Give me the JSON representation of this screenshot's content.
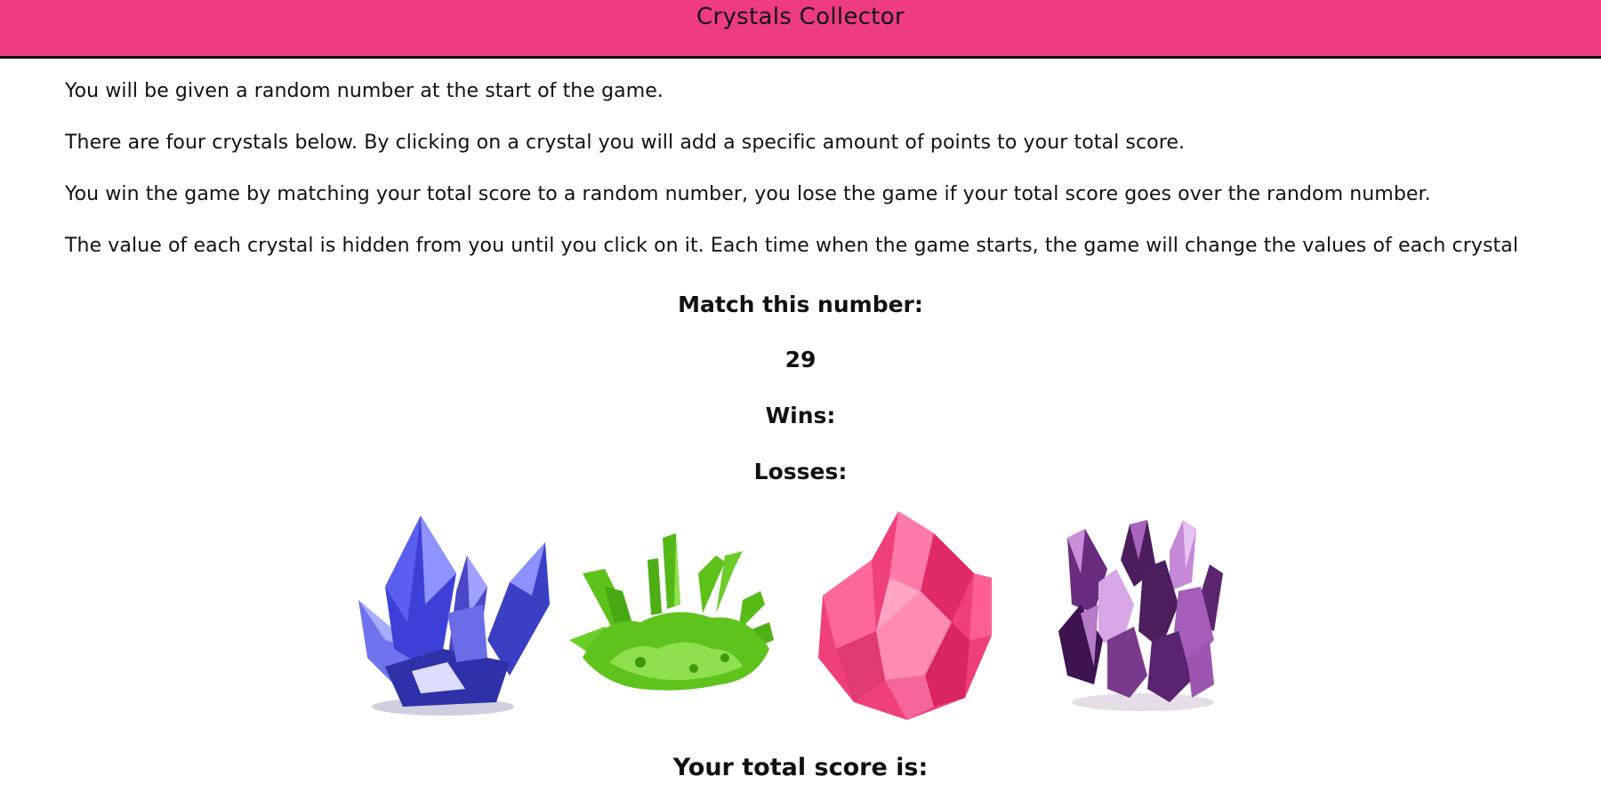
{
  "header": {
    "title": "Crystals Collector",
    "color": "#ee3b82"
  },
  "instructions": [
    "You will be given a random number at the start of the game.",
    "There are four crystals below. By clicking on a crystal you will add a specific amount of points to your total score.",
    "You win the game by matching your total score to a random number, you lose the game if your total score goes over the random number.",
    "The value of each crystal is hidden from you until you click on it. Each time when the game starts, the game will change the values of each crystal"
  ],
  "game": {
    "match_label": "Match this number:",
    "target_number": "29",
    "wins_label": "Wins:",
    "losses_label": "Losses:",
    "score_label": "Your total score is:"
  },
  "crystals": [
    {
      "name": "blue-crystal",
      "color": "#4b4fe0"
    },
    {
      "name": "green-crystal",
      "color": "#5cc21a"
    },
    {
      "name": "pink-crystal",
      "color": "#f0407a"
    },
    {
      "name": "purple-crystal",
      "color": "#7a3a8c"
    }
  ]
}
